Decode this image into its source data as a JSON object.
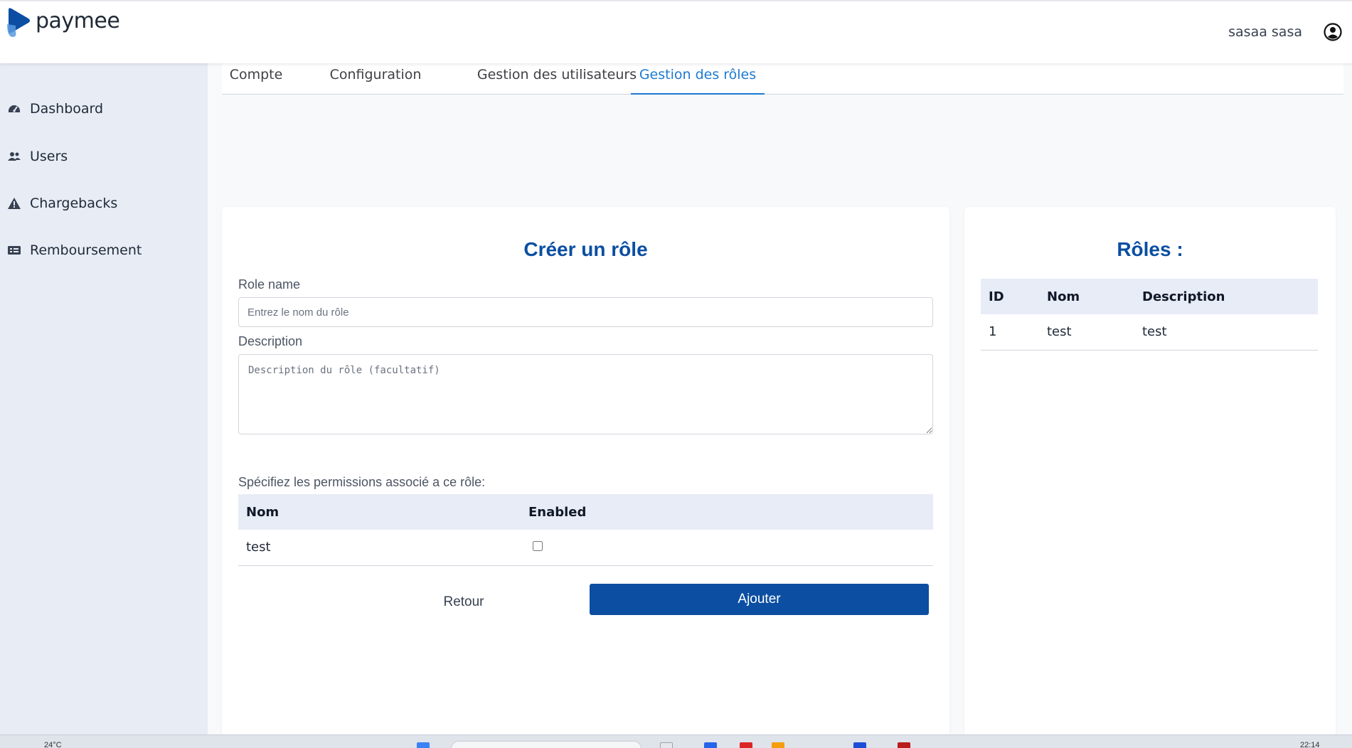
{
  "app": {
    "logo_text": "paymee",
    "user_name": "sasaa sasa"
  },
  "sidebar": {
    "items": [
      {
        "label": "Dashboard",
        "icon": "dashboard-icon"
      },
      {
        "label": "Users",
        "icon": "users-icon"
      },
      {
        "label": "Chargebacks",
        "icon": "warning-icon"
      },
      {
        "label": "Remboursement",
        "icon": "receipt-icon"
      }
    ]
  },
  "tabs": [
    {
      "label": "Compte",
      "active": false
    },
    {
      "label": "Configuration",
      "active": false
    },
    {
      "label": "Gestion des utilisateurs",
      "active": false
    },
    {
      "label": "Gestion des rôles",
      "active": true
    }
  ],
  "create_role": {
    "title": "Créer un rôle",
    "role_name_label": "Role name",
    "role_name_value": "",
    "role_name_placeholder": "Entrez le nom du rôle",
    "description_label": "Description",
    "description_value": "",
    "description_placeholder": "Description du rôle (facultatif)",
    "permissions_label": "Spécifiez les permissions associé a ce rôle:",
    "permissions_table": {
      "headers": [
        "Nom",
        "Enabled"
      ],
      "rows": [
        {
          "name": "test",
          "enabled": false
        }
      ]
    },
    "back_button": "Retour",
    "add_button": "Ajouter"
  },
  "roles": {
    "title": "Rôles :",
    "headers": [
      "ID",
      "Nom",
      "Description"
    ],
    "rows": [
      {
        "id": "1",
        "name": "test",
        "description": "test"
      }
    ]
  },
  "taskbar": {
    "weather": "24°C",
    "clock": "22:14"
  },
  "colors": {
    "accent": "#0b4ea2",
    "tab_active": "#1d7ad1",
    "sidebar_bg": "#e7ecf5",
    "table_header_bg": "#e7ecf7"
  }
}
